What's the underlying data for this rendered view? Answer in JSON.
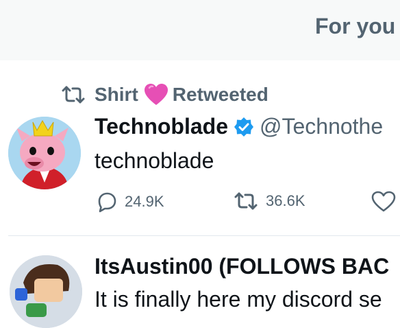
{
  "header": {
    "tab_label": "For you"
  },
  "tweets": [
    {
      "retweet_by": "Shirt",
      "retweet_suffix": "Retweeted",
      "author_name": "Technoblade",
      "handle": "@Technothe",
      "text": "technoblade",
      "replies": "24.9K",
      "retweets": "36.6K",
      "icons": [
        "retweet-icon",
        "pink-heart-emoji",
        "verified-badge-icon",
        "reply-icon",
        "retweet-icon",
        "like-icon"
      ],
      "colors": {
        "verified": "#1d9bf0",
        "muted": "#536471"
      }
    },
    {
      "author_name": "ItsAustin00 (FOLLOWS BAC",
      "text": "It is finally here my discord se"
    }
  ]
}
